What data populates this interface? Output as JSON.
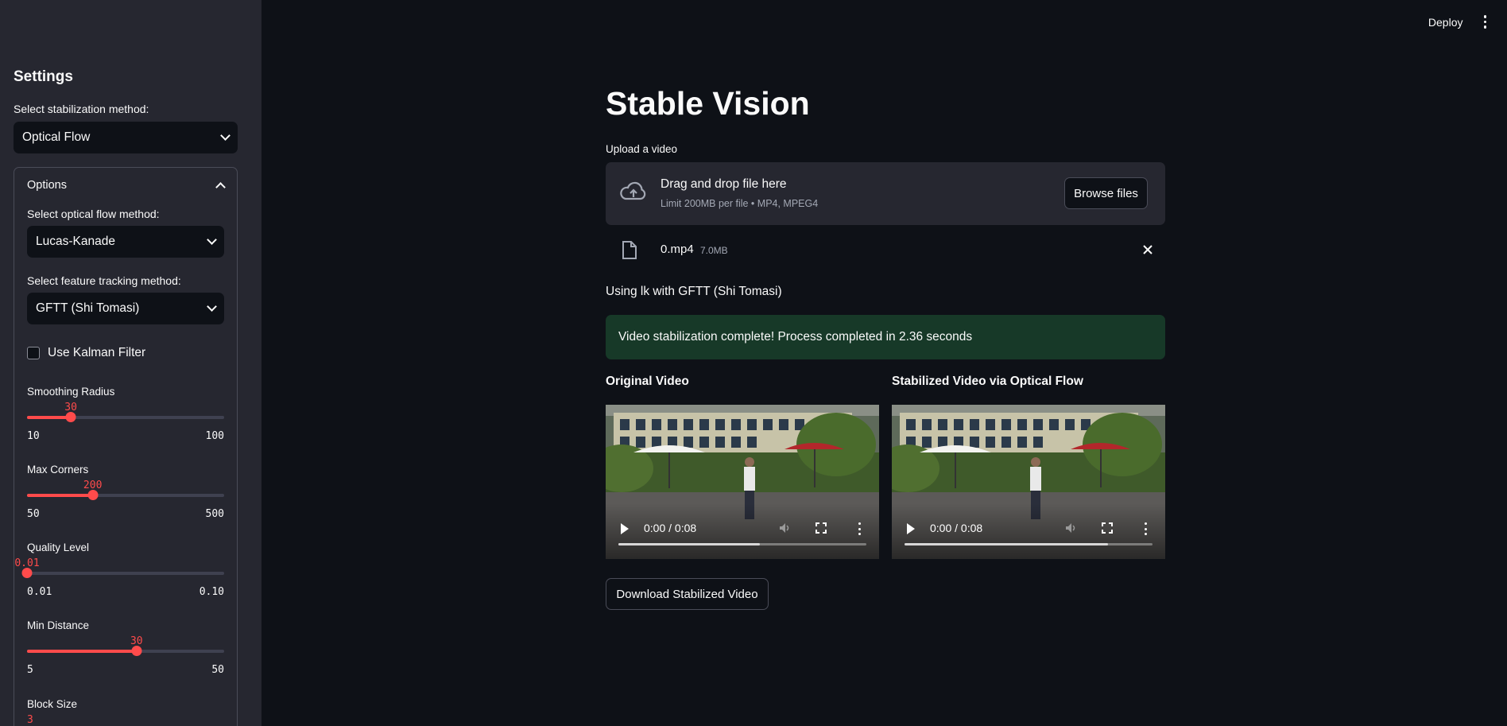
{
  "topbar": {
    "deploy_label": "Deploy"
  },
  "sidebar": {
    "title": "Settings",
    "method_label": "Select stabilization method:",
    "method_value": "Optical Flow",
    "options": {
      "header": "Options",
      "flow_label": "Select optical flow method:",
      "flow_value": "Lucas-Kanade",
      "tracking_label": "Select feature tracking method:",
      "tracking_value": "GFTT (Shi Tomasi)",
      "kalman_label": "Use Kalman Filter",
      "kalman_checked": false,
      "sliders": [
        {
          "label": "Smoothing Radius",
          "value": "30",
          "min": "10",
          "max": "100",
          "fraction": 0.2222
        },
        {
          "label": "Max Corners",
          "value": "200",
          "min": "50",
          "max": "500",
          "fraction": 0.3333
        },
        {
          "label": "Quality Level",
          "value": "0.01",
          "min": "0.01",
          "max": "0.10",
          "fraction": 0
        },
        {
          "label": "Min Distance",
          "value": "30",
          "min": "5",
          "max": "50",
          "fraction": 0.5556
        },
        {
          "label": "Block Size",
          "value": "3"
        }
      ]
    }
  },
  "main": {
    "title": "Stable Vision",
    "upload_label": "Upload a video",
    "dropzone": {
      "title": "Drag and drop file here",
      "subtitle": "Limit 200MB per file • MP4, MPEG4",
      "browse_label": "Browse files"
    },
    "file": {
      "name": "0.mp4",
      "size": "7.0MB"
    },
    "info_text": "Using lk with GFTT (Shi Tomasi)",
    "success_text": "Video stabilization complete! Process completed in 2.36 seconds",
    "videos": [
      {
        "label": "Original Video",
        "time": "0:00 / 0:08",
        "buffered": 0.57
      },
      {
        "label": "Stabilized Video via Optical Flow",
        "time": "0:00 / 0:08",
        "buffered": 0.82
      }
    ],
    "download_label": "Download Stabilized Video"
  },
  "colors": {
    "accent": "#ff4b4b",
    "success_bg": "#173928",
    "sidebar_bg": "#262730",
    "app_bg": "#0e1117"
  }
}
